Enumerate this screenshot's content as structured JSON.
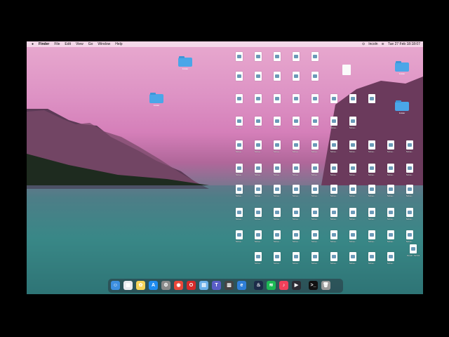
{
  "menubar": {
    "app": "Finder",
    "items": [
      "File",
      "Edit",
      "View",
      "Go",
      "Window",
      "Help"
    ],
    "clock": "Tue 27 Feb  18:18:07",
    "status": "Incoln"
  },
  "desktop": {
    "folders": [
      {
        "label": "Folder"
      },
      {
        "label": "Folder"
      },
      {
        "label": "Folder"
      },
      {
        "label": "Folder"
      }
    ],
    "file_label_prefix": "Scree...",
    "last_file_label": "Touch...52.04"
  },
  "dock": {
    "apps": [
      "finder-icon",
      "launchpad-icon",
      "photos-icon",
      "app-store-icon",
      "settings-icon",
      "chrome-icon",
      "opera-icon",
      "preview-icon",
      "teams-icon",
      "calculator-icon",
      "edge-icon",
      "steam-icon",
      "spotify-icon",
      "music-icon",
      "quicktime-icon",
      "terminal-icon",
      "trash-icon"
    ]
  }
}
